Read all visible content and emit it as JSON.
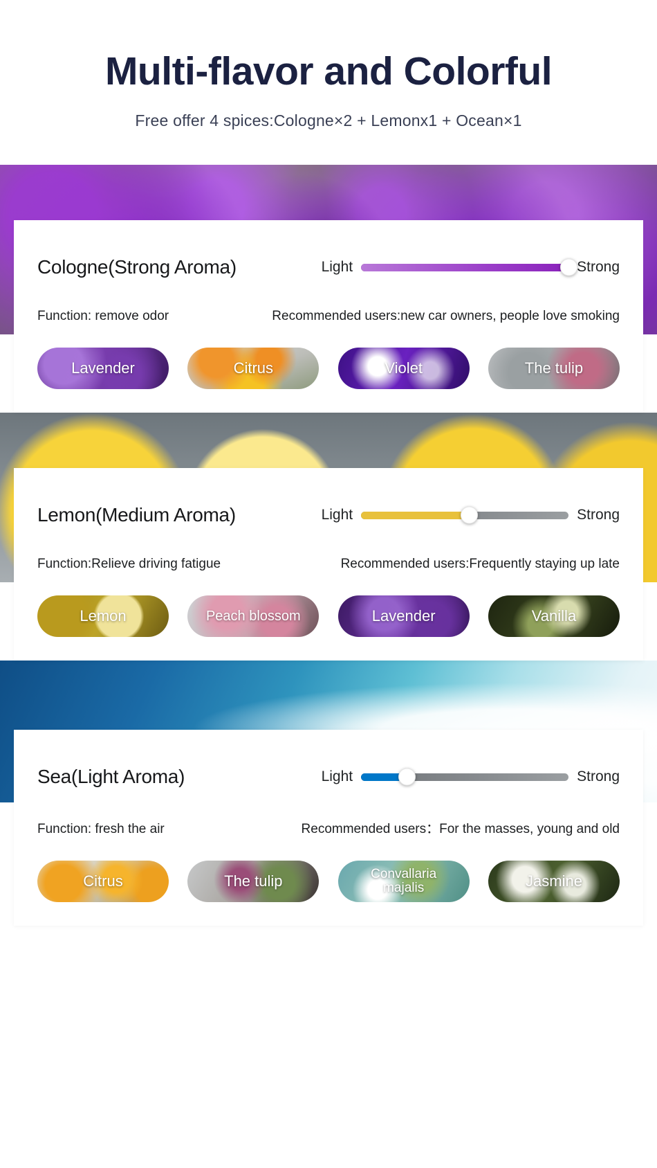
{
  "header": {
    "title": "Multi-flavor and Colorful",
    "subtitle": "Free offer 4 spices:Cologne×2 + Lemonx1 + Ocean×1",
    "title_color": "#1b2141"
  },
  "slider_labels": {
    "min": "Light",
    "max": "Strong"
  },
  "scents": [
    {
      "name": "Cologne(Strong Aroma)",
      "slider": {
        "value_percent": 100,
        "fill_color": "#9b3fc9",
        "track_color": "#7f8386"
      },
      "function": "Function: remove odor",
      "users": "Recommended users:new car owners, people love smoking",
      "chips": [
        {
          "label": "Lavender"
        },
        {
          "label": "Citrus"
        },
        {
          "label": "Violet"
        },
        {
          "label": "The tulip"
        }
      ]
    },
    {
      "name": "Lemon(Medium Aroma)",
      "slider": {
        "value_percent": 52,
        "fill_color": "#e8c13c",
        "track_color": "#7f8386"
      },
      "function": "Function:Relieve driving fatigue",
      "users": "Recommended users:Frequently staying up late",
      "chips": [
        {
          "label": "Lemon"
        },
        {
          "label": "Peach blossom"
        },
        {
          "label": "Lavender"
        },
        {
          "label": "Vanilla"
        }
      ]
    },
    {
      "name": "Sea(Light Aroma)",
      "slider": {
        "value_percent": 22,
        "fill_color": "#0077c8",
        "track_color": "#7f8386"
      },
      "function": "Function: fresh the air",
      "users": "Recommended users：For the masses, young and old",
      "chips": [
        {
          "label": "Citrus"
        },
        {
          "label": "The tulip"
        },
        {
          "label": "Convallaria\nmajalis"
        },
        {
          "label": "Jasmine"
        }
      ]
    }
  ]
}
